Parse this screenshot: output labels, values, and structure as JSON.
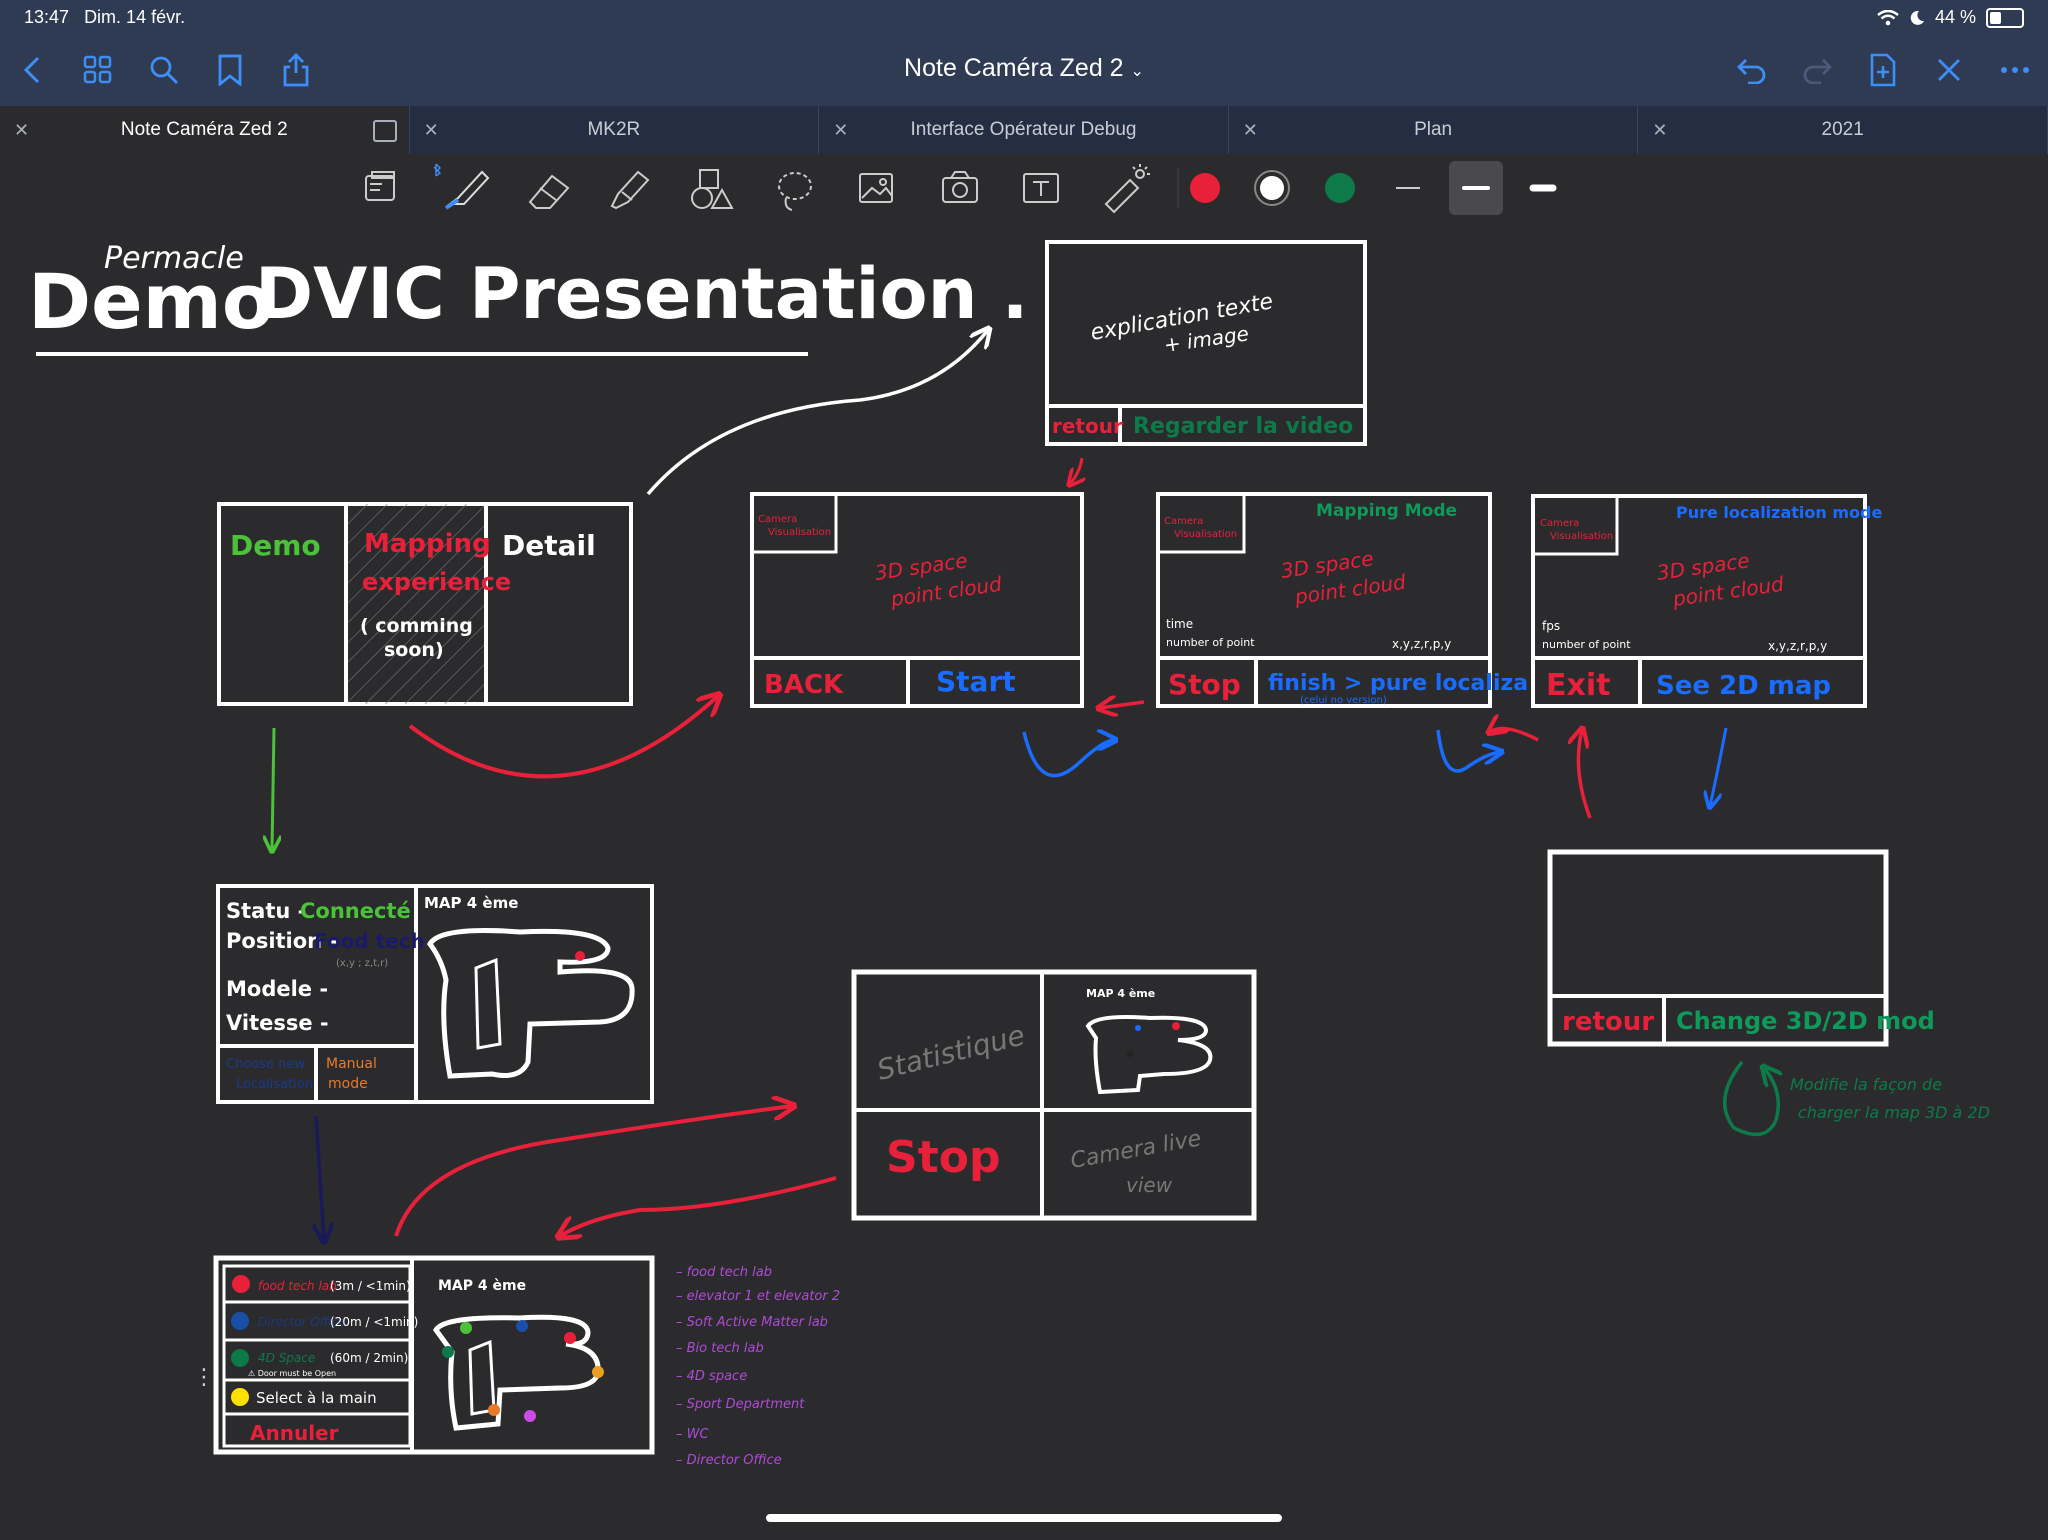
{
  "status_bar": {
    "time": "13:47",
    "date": "Dim. 14 févr.",
    "battery": "44 %",
    "battery_level": 0.44
  },
  "nav": {
    "title": "Note Caméra Zed 2"
  },
  "tabs": [
    {
      "label": "Note Caméra Zed 2",
      "active": true
    },
    {
      "label": "MK2R",
      "active": false
    },
    {
      "label": "Interface Opérateur Debug",
      "active": false
    },
    {
      "label": "Plan",
      "active": false
    },
    {
      "label": "2021",
      "active": false
    }
  ],
  "colors": {
    "red": "#e8203a",
    "white": "#ffffff",
    "green": "#0d7a4a",
    "accent": "#3e8ef7",
    "hand_green": "#4cc23a",
    "hand_blue": "#1a6cff",
    "hand_purple": "#b04ad8"
  },
  "toolbar": {
    "icons": [
      "page-layout-icon",
      "pen-icon",
      "eraser-icon",
      "highlighter-icon",
      "shapes-icon",
      "lasso-icon",
      "image-icon",
      "camera-icon",
      "text-icon",
      "laser-pointer-icon"
    ]
  },
  "note": {
    "title_small": "Permacle",
    "title_demo": "Demo",
    "title_rest": "DVIC   Presentation .",
    "explain_box": {
      "text1": "explication texte",
      "text2": "+ image",
      "retour": "retour",
      "record": "Regarder la video"
    },
    "menu_box": {
      "demo": "Demo",
      "mapping": "Mapping",
      "experience": "experience",
      "coming1": "( comming",
      "coming2": "soon)",
      "detail": "Detail"
    },
    "screen1": {
      "cam1": "Camera",
      "cam2": "Visualisation",
      "space1": "3D space",
      "space2": "point cloud",
      "back": "BACK",
      "start": "Start"
    },
    "screen2": {
      "cam1": "Camera",
      "cam2": "Visualisation",
      "mode": "Mapping Mode",
      "space1": "3D space",
      "space2": "point cloud",
      "time": "time",
      "points": "number of point",
      "coords": "x,y,z,r,p,y",
      "stop": "Stop",
      "finish": "finish > pure localiza",
      "sub": "(celui no version)"
    },
    "screen3": {
      "cam1": "Camera",
      "cam2": "Visualisation",
      "mode": "Pure localization mode",
      "space1": "3D space",
      "space2": "point cloud",
      "fps": "fps",
      "points": "number of point",
      "coords": "x,y,z,r,p,y",
      "exit": "Exit",
      "see2d": "See 2D map"
    },
    "screen4": {
      "retour": "retour",
      "change": "Change 3D/2D mod"
    },
    "side_note": {
      "line1": "Modifie la façon de",
      "line2": "charger la map 3D à 2D"
    },
    "status_box": {
      "statu": "Statu -",
      "connected": "Connecté",
      "position": "Position -",
      "food": "Food tech",
      "coords": "(x,y ; z,t,r)",
      "modele": "Modele -",
      "vitesse": "Vitesse -",
      "map": "MAP 4 ème",
      "choose1": "Choose new",
      "choose2": "Localisation",
      "manual1": "Manual",
      "manual2": "mode"
    },
    "stats_box": {
      "stat": "Statistique",
      "map": "MAP 4 ème",
      "stop": "Stop",
      "cam1": "Camera live",
      "cam2": "view"
    },
    "dest_box": {
      "rows": [
        {
          "name": "food tech lab",
          "info": "(3m / <1min)",
          "color": "#e8203a"
        },
        {
          "name": "Director Office",
          "info": "(20m / <1min)",
          "color": "#1a4fa8"
        },
        {
          "name": "4D Space",
          "info": "(60m / 2min)",
          "color": "#0d7a4a"
        }
      ],
      "warn": "⚠ Door must be Open",
      "select": "Select à la main",
      "annuler": "Annuler",
      "map": "MAP 4 ème"
    },
    "legend": [
      "food tech lab",
      "elevator 1 et elevator 2",
      "Soft Active Matter lab",
      "Bio tech lab",
      "4D space",
      "Sport Department",
      "WC",
      "Director Office"
    ]
  }
}
